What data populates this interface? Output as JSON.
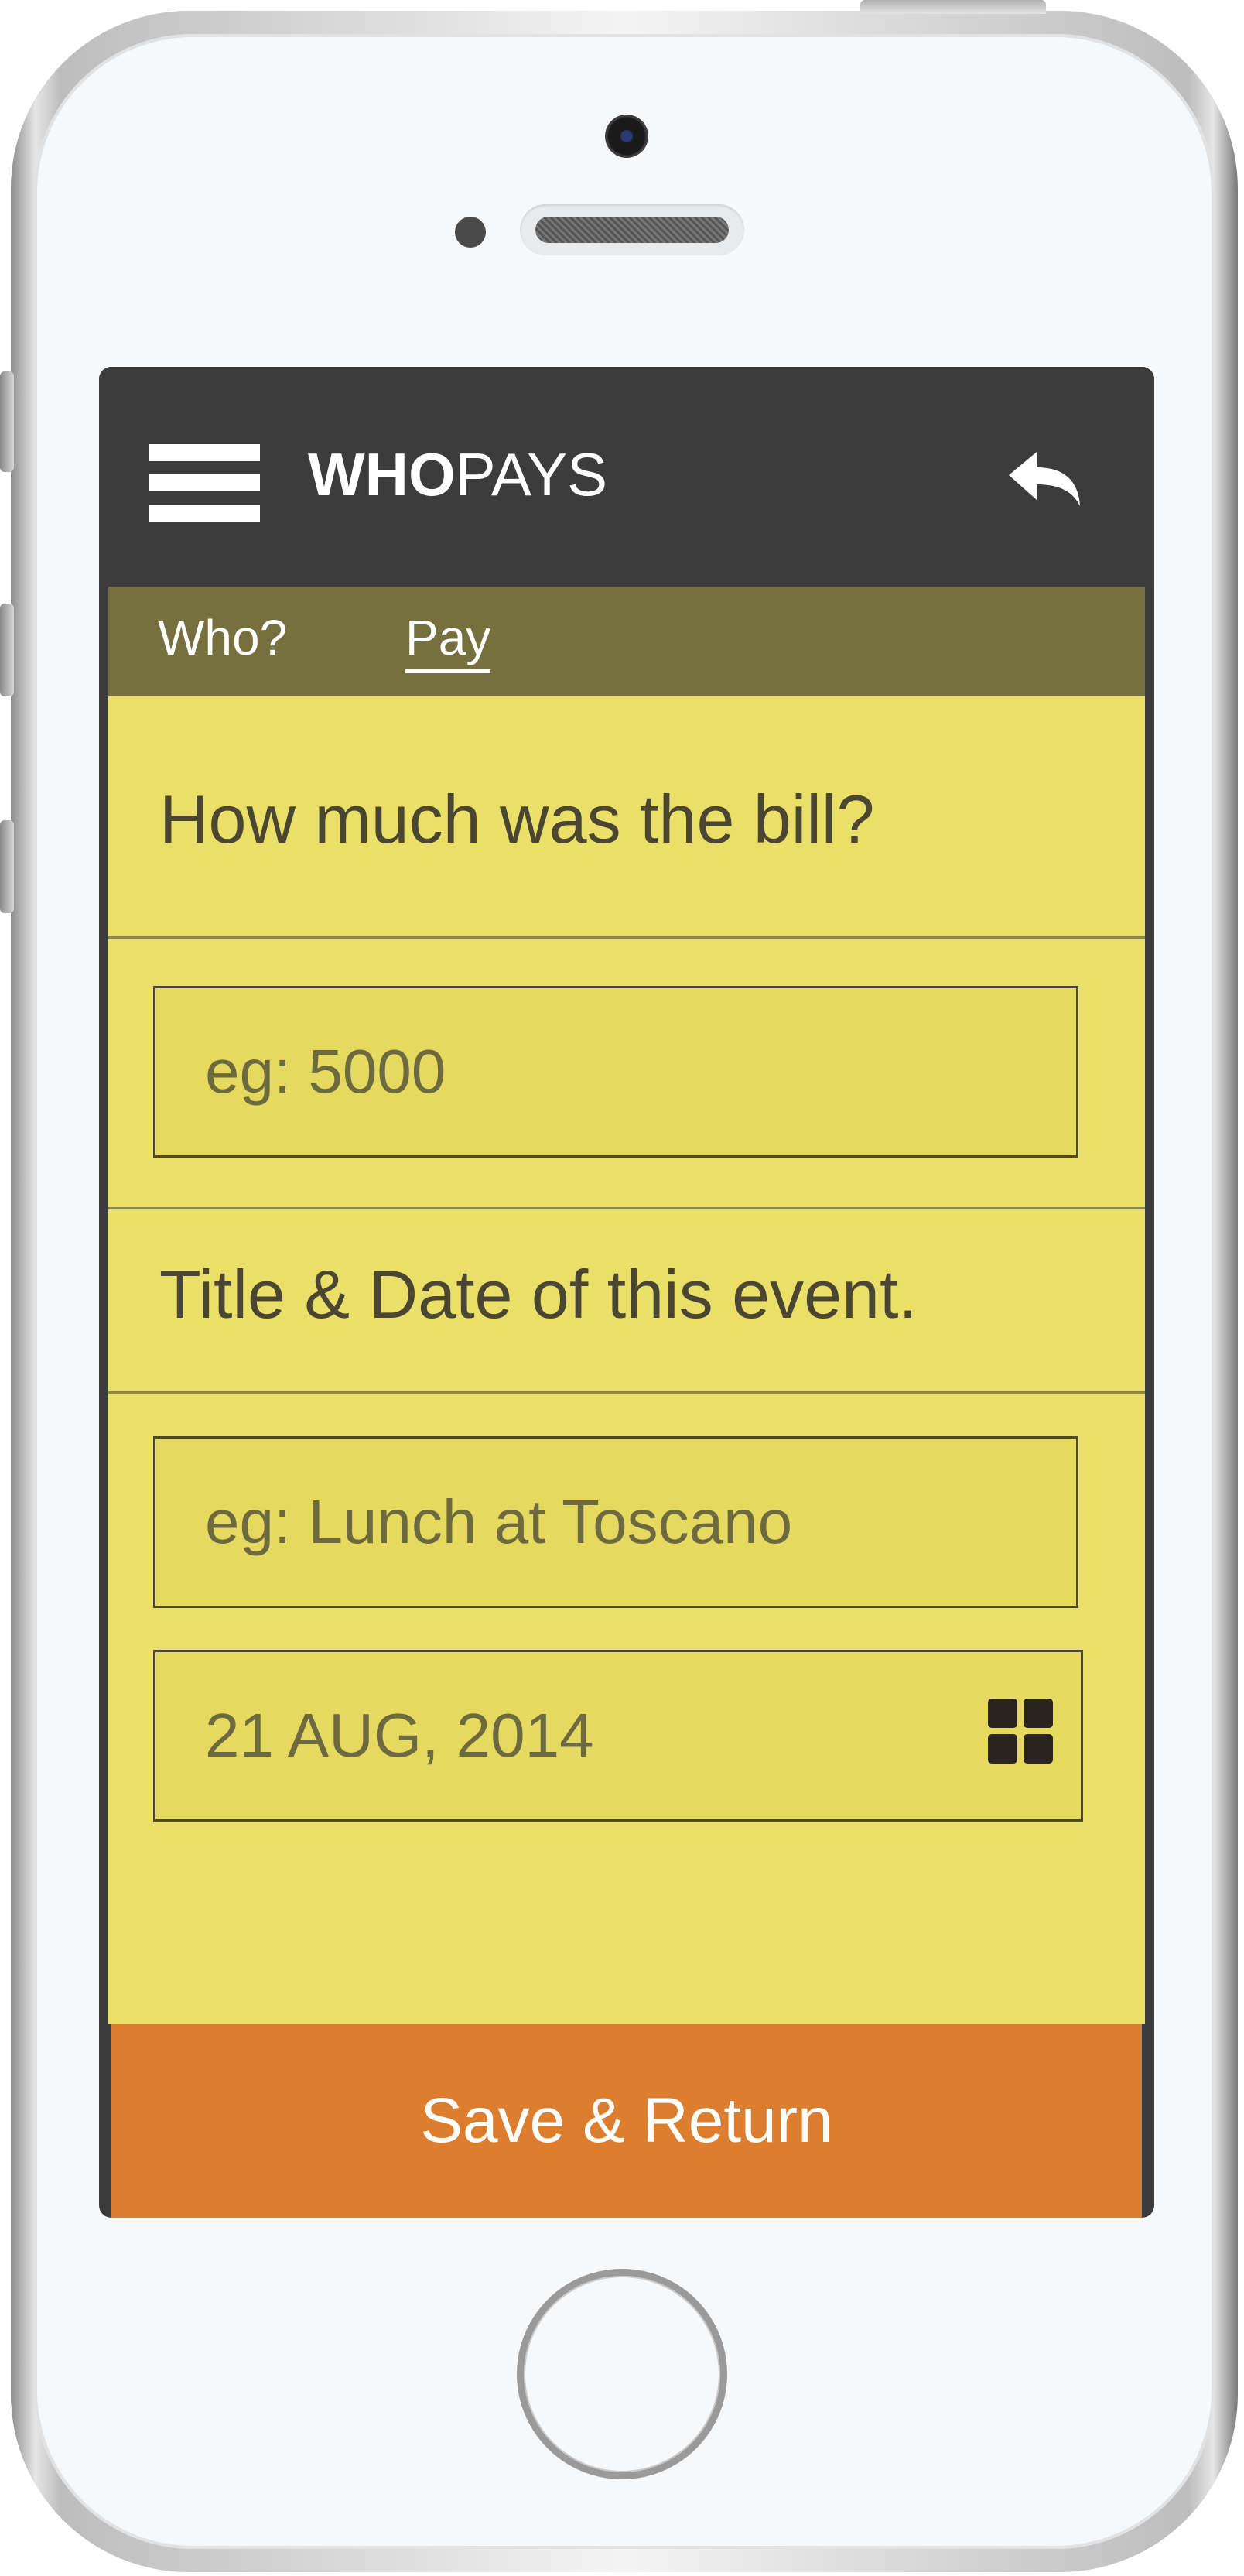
{
  "app": {
    "brand_bold": "WHO",
    "brand_light": "PAYS"
  },
  "tabs": [
    {
      "label": "Who?",
      "active": false
    },
    {
      "label": "Pay",
      "active": true
    }
  ],
  "bill": {
    "question": "How much was the bill?",
    "amount_placeholder": "eg: 5000"
  },
  "event": {
    "question": "Title & Date of this event.",
    "title_placeholder": "eg: Lunch at Toscano",
    "date_value": "21 AUG, 2014"
  },
  "actions": {
    "save_label": "Save & Return"
  },
  "icons": {
    "menu": "hamburger-menu-icon",
    "back": "reply-arrow-icon",
    "calendar": "grid-calendar-icon"
  },
  "colors": {
    "header": "#3c3c3c",
    "tab_bar": "#76703f",
    "content_bg": "#e9df69",
    "save_button": "#dd7e2e"
  }
}
